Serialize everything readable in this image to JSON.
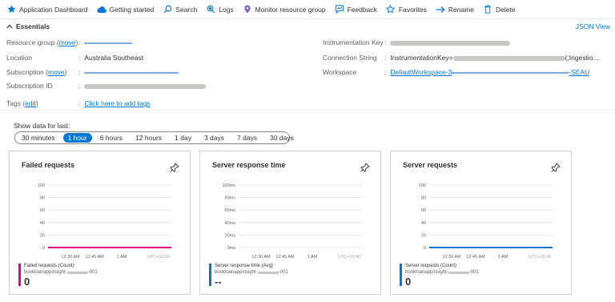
{
  "toolbar": {
    "items": [
      {
        "label": "Application Dashboard",
        "icon": "star-filled-icon"
      },
      {
        "label": "Getting started",
        "icon": "cloud-icon"
      },
      {
        "label": "Search",
        "icon": "search-icon"
      },
      {
        "label": "Logs",
        "icon": "logs-icon"
      },
      {
        "label": "Monitor resource group",
        "icon": "location-pin-icon"
      },
      {
        "label": "Feedback",
        "icon": "feedback-icon"
      },
      {
        "label": "Favorites",
        "icon": "star-outline-icon"
      },
      {
        "label": "Rename",
        "icon": "arrow-right-icon"
      },
      {
        "label": "Delete",
        "icon": "trash-icon"
      }
    ]
  },
  "essentials": {
    "title": "Essentials",
    "json_view": "JSON View",
    "left": {
      "resource_group_label": "Resource group",
      "resource_group_move": "move",
      "location_label": "Location",
      "location_value": "Australia Southeast",
      "subscription_label": "Subscription",
      "subscription_move": "move",
      "subscription_id_label": "Subscription ID",
      "tags_label": "Tags",
      "tags_edit": "edit",
      "tags_value": "Click here to add tags"
    },
    "right": {
      "ikey_label": "Instrumentation Key",
      "conn_label": "Connection String",
      "conn_prefix": "InstrumentationKey=",
      "conn_suffix": "(;Ingestio...",
      "workspace_label": "Workspace",
      "workspace_prefix": "DefaultWorkspace-3",
      "workspace_suffix": "-SEAU"
    }
  },
  "time_range": {
    "label": "Show data for last:",
    "options": [
      "30 minutes",
      "1 hour",
      "6 hours",
      "12 hours",
      "1 day",
      "3 days",
      "7 days",
      "30 days"
    ],
    "selected": "1 hour"
  },
  "cards": [
    {
      "title": "Failed requests",
      "color": "#e3008c",
      "legend_title": "Failed requests (Count)",
      "legend_sub_prefix": "bookloanappinsight-",
      "legend_sub_suffix": "-001",
      "legend_value": "0"
    },
    {
      "title": "Server response time",
      "color": "#0078d4",
      "legend_title": "Server response time (Avg)",
      "legend_sub_prefix": "bookloanappinsight-",
      "legend_sub_suffix": "-001",
      "legend_value": "--"
    },
    {
      "title": "Server requests",
      "color": "#0078d4",
      "legend_title": "Server requests (Count)",
      "legend_sub_prefix": "bookloanappinsight-",
      "legend_sub_suffix": "-001",
      "legend_value": "0"
    }
  ],
  "chart_data": [
    {
      "type": "line",
      "title": "Failed requests",
      "y_ticks": [
        "100",
        "80",
        "60",
        "40",
        "20",
        "0"
      ],
      "ylim": [
        0,
        100
      ],
      "x_ticks": [
        "12:30 AM",
        "12:45 AM",
        "1 AM",
        "UTC+10:00"
      ],
      "series": [
        {
          "name": "Failed requests (Count)",
          "values": [
            0,
            0
          ]
        }
      ]
    },
    {
      "type": "line",
      "title": "Server response time",
      "y_ticks": [
        "100ms",
        "80ms",
        "60ms",
        "40ms",
        "20ms",
        "0ms"
      ],
      "ylim": [
        0,
        100
      ],
      "x_ticks": [
        "12:30 AM",
        "12:45 AM",
        "1 AM",
        "UTC+10:00"
      ],
      "series": [
        {
          "name": "Server response time (Avg)",
          "values": []
        }
      ]
    },
    {
      "type": "line",
      "title": "Server requests",
      "y_ticks": [
        "100",
        "80",
        "60",
        "40",
        "20",
        "0"
      ],
      "ylim": [
        0,
        100
      ],
      "x_ticks": [
        "12:30 AM",
        "12:45 AM",
        "1 AM",
        "UTC+10:00"
      ],
      "series": [
        {
          "name": "Server requests (Count)",
          "values": [
            0,
            0
          ]
        }
      ]
    }
  ]
}
